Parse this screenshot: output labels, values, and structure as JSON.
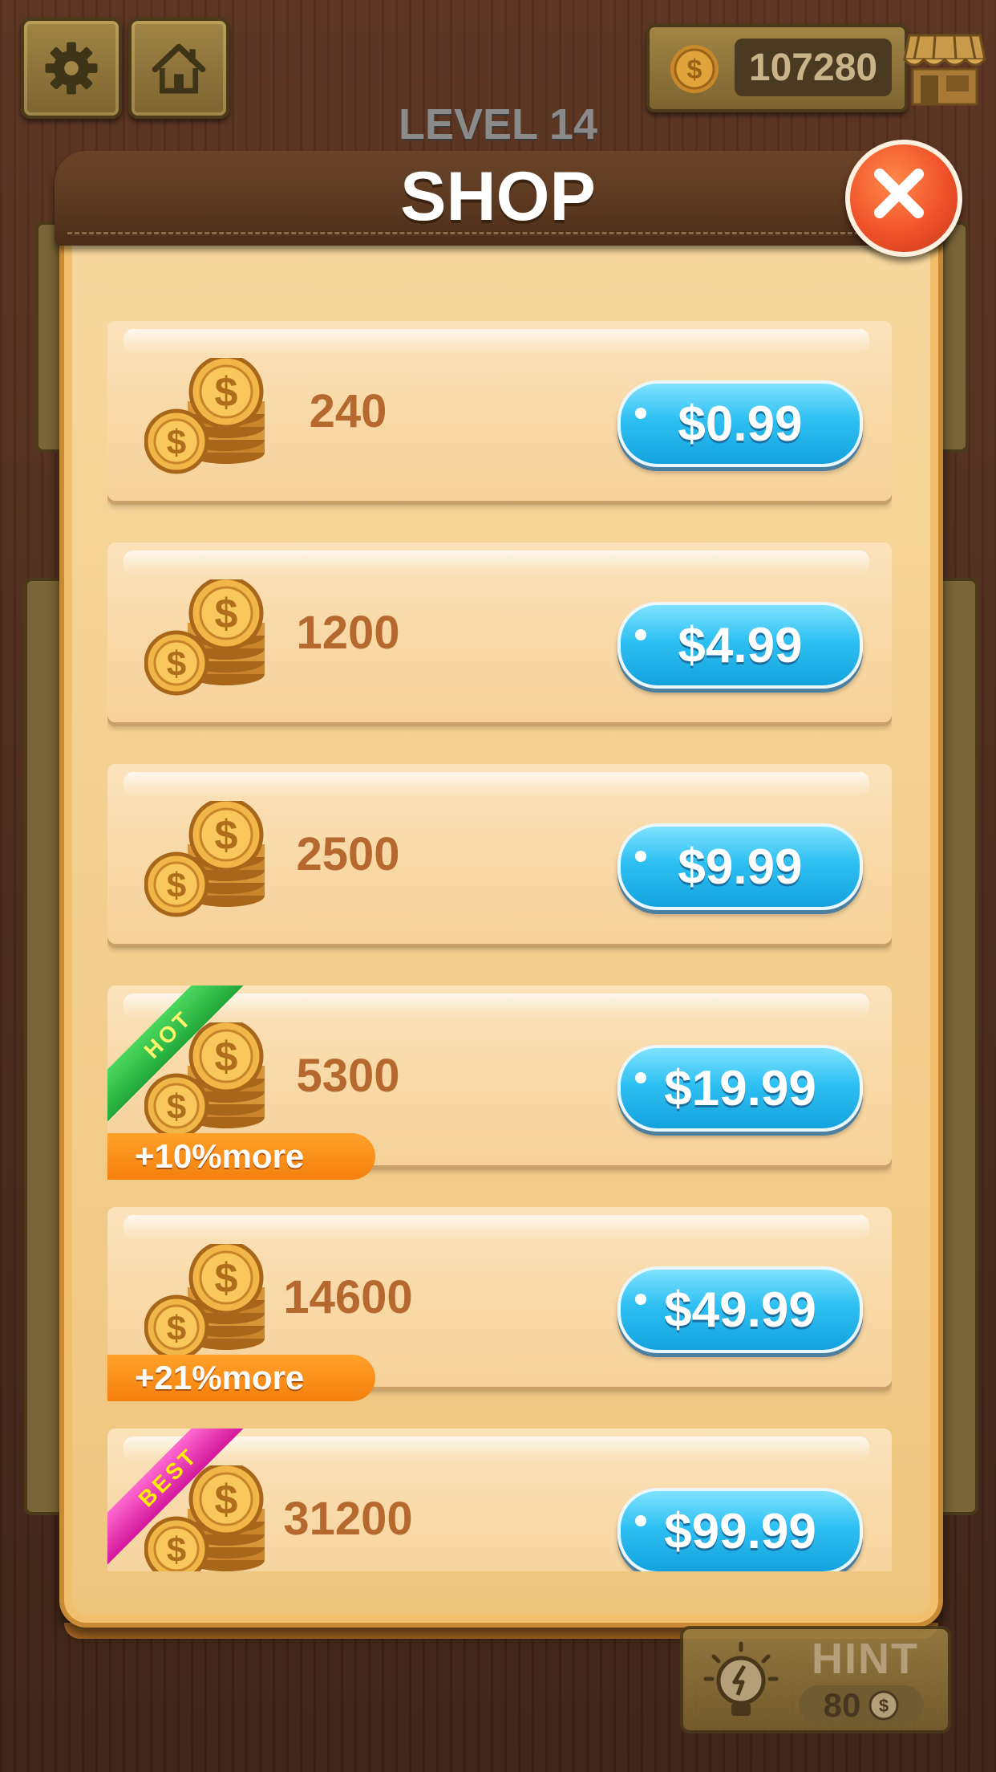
{
  "topbar": {
    "settings_icon": "gear-icon",
    "home_icon": "house-icon",
    "coin_balance": "107280",
    "shop_icon": "shop-stall-icon"
  },
  "level_label": "LEVEL 14",
  "shop": {
    "title": "SHOP",
    "close_icon": "close-icon",
    "items": [
      {
        "amount": "240",
        "price": "$0.99"
      },
      {
        "amount": "1200",
        "price": "$4.99"
      },
      {
        "amount": "2500",
        "price": "$9.99"
      },
      {
        "amount": "5300",
        "price": "$19.99",
        "ribbon": "HOT",
        "bonus": "+10%more"
      },
      {
        "amount": "14600",
        "price": "$49.99",
        "bonus": "+21%more"
      },
      {
        "amount": "31200",
        "price": "$99.99",
        "ribbon": "BEST"
      }
    ]
  },
  "hint": {
    "label": "HINT",
    "cost": "80",
    "icon": "lightbulb-icon"
  },
  "colors": {
    "price_button": "#2ec0f2",
    "bonus_badge": "#f57f0c",
    "amount_text": "#b6692f",
    "close_button": "#f0522a",
    "hot_ribbon": "#22a83a",
    "best_ribbon": "#d4189c"
  }
}
